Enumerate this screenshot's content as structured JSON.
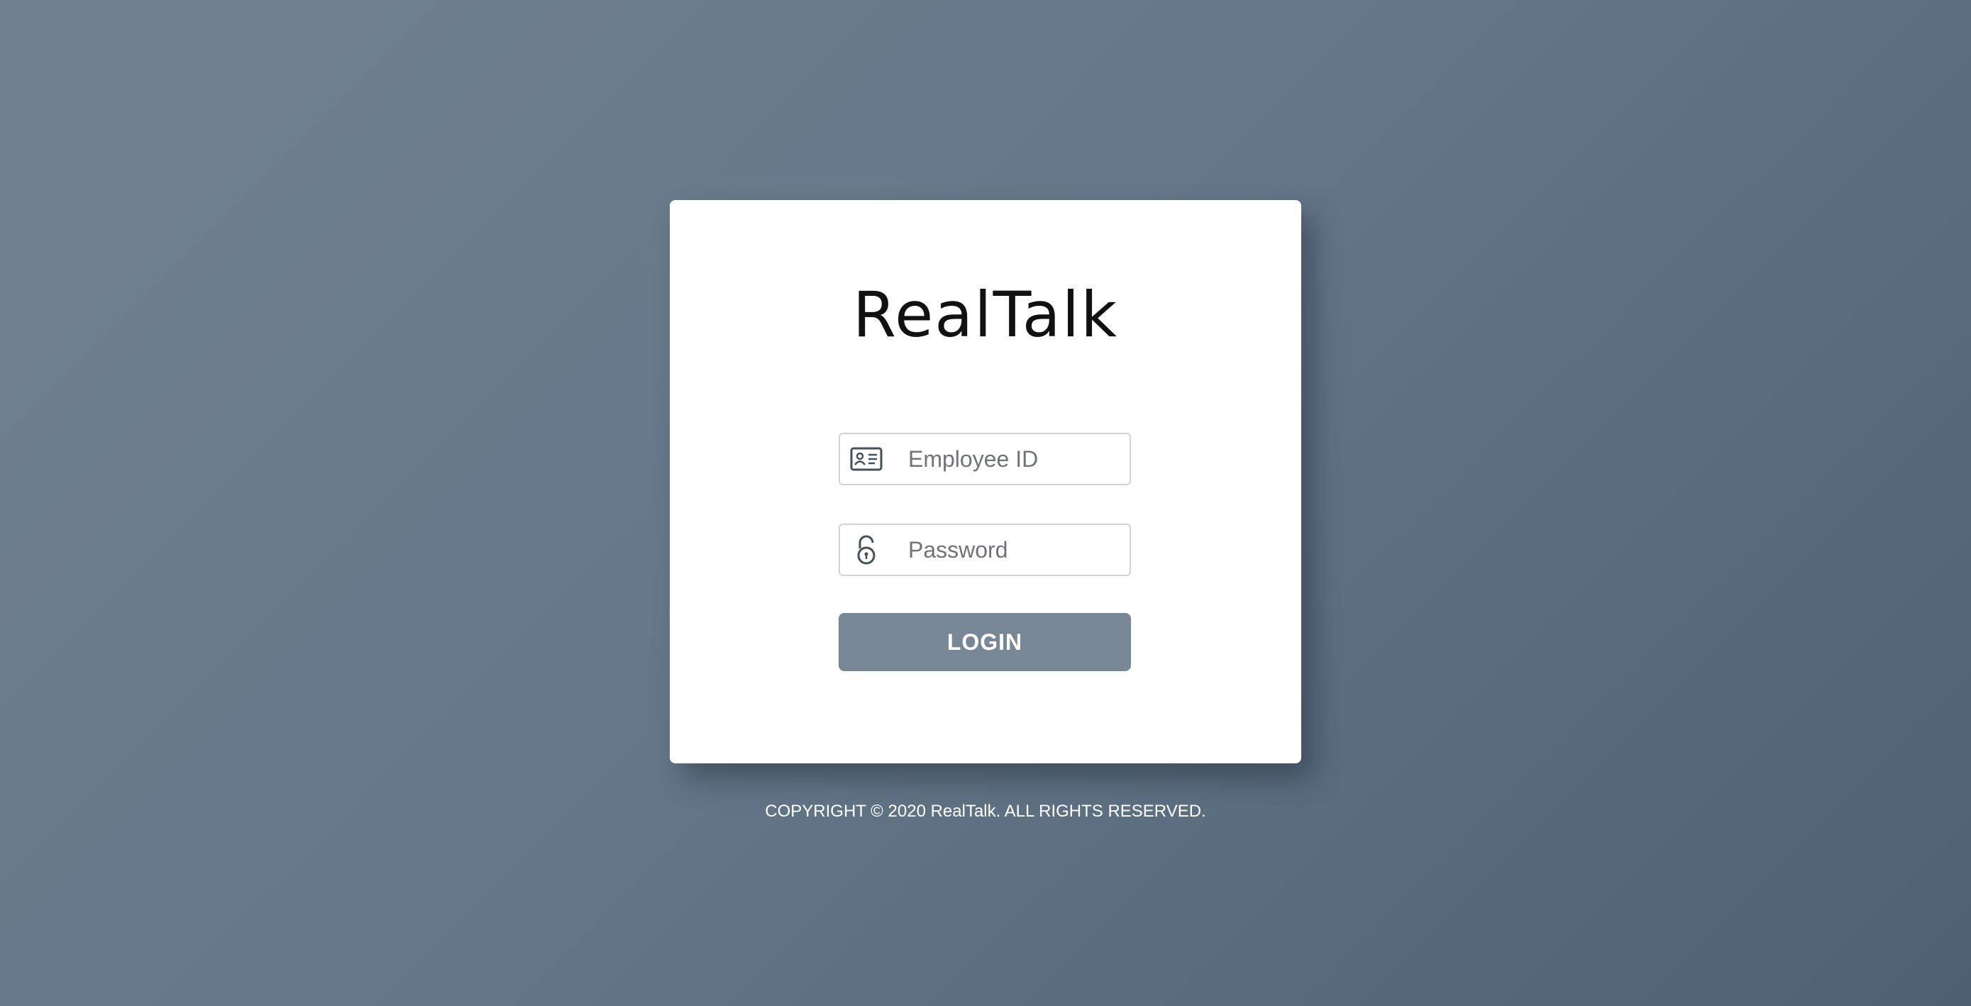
{
  "app": {
    "title": "RealTalk"
  },
  "form": {
    "employee_id": {
      "placeholder": "Employee ID",
      "value": "",
      "icon": "id-card-icon"
    },
    "password": {
      "placeholder": "Password",
      "value": "",
      "icon": "unlock-icon"
    },
    "login_label": "LOGIN"
  },
  "footer": {
    "copyright": "COPYRIGHT © 2020 RealTalk. ALL RIGHTS RESERVED."
  },
  "colors": {
    "background_start": "#71808e",
    "background_end": "#4e6072",
    "card": "#ffffff",
    "button": "#778796",
    "icon": "#44505c"
  }
}
